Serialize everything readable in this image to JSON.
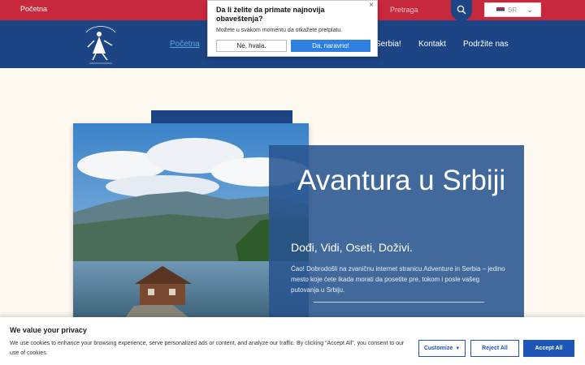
{
  "topbar": {
    "home_link": "Početna",
    "search_placeholder": "Pretraga",
    "language": "SR"
  },
  "nav": {
    "items": [
      "Početna",
      "Serbia!",
      "Kontakt",
      "Podržite nas"
    ],
    "active_index": 0
  },
  "hero": {
    "title": "Avantura u Srbiji",
    "subtitle": "Dođi, Vidi, Oseti, Doživi.",
    "body": "Ćao! Dobrodošli na zvaničnu internet stranicu Adventure in Serbia – jedino mesto koje ćete ikada morati da posetite pre, tokom i posle vašeg putovanja u Srbiju."
  },
  "push_prompt": {
    "question": "Da li želite da primate najnovija obaveštenja?",
    "note": "Možete u svakom momentu da otkažete pretplatu.",
    "decline_label": "Ne, hvala.",
    "accept_label": "Da, naravno!"
  },
  "cookie_banner": {
    "title": "We value your privacy",
    "text": "We use cookies to enhance your browsing experience, serve personalized ads or content, and analyze our traffic. By clicking \"Accept All\", you consent to our use of cookies.",
    "customize_label": "Customize",
    "reject_label": "Reject All",
    "accept_label": "Accept All"
  },
  "colors": {
    "topbar": "#c8283c",
    "nav": "#1d4585",
    "panel": "#285490",
    "primary_button": "#1d55b8"
  }
}
